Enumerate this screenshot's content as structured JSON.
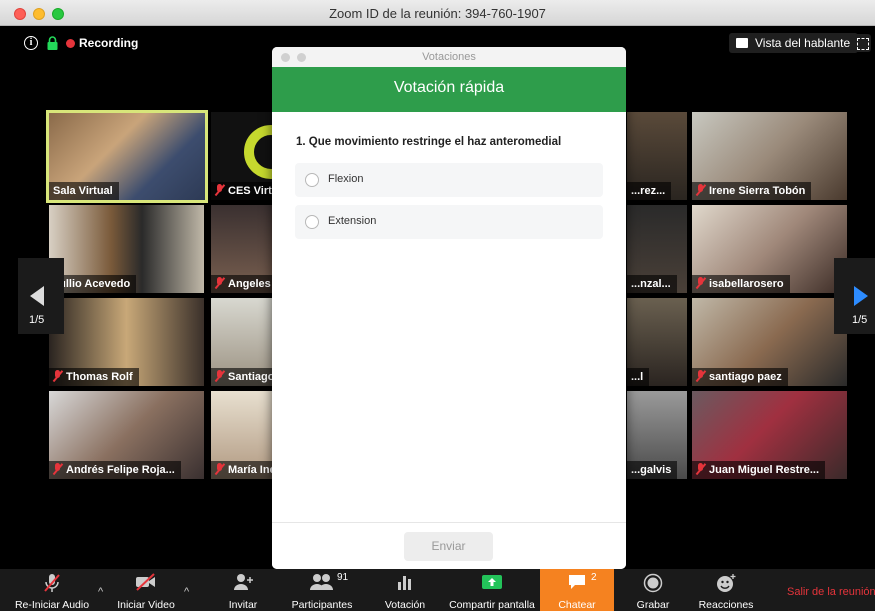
{
  "window": {
    "title": "Zoom ID de la reunión: 394-760-1907"
  },
  "topbar": {
    "recording_label": "Recording",
    "speaker_view_label": "Vista del hablante"
  },
  "grid": {
    "page_left": "1/5",
    "page_right": "1/5",
    "tiles": [
      {
        "name": "Sala Virtual",
        "muted": false
      },
      {
        "name": "CES Virtu",
        "muted": true
      },
      {
        "name": "...rez...",
        "muted": false
      },
      {
        "name": "Irene Sierra Tobón",
        "muted": true
      },
      {
        "name": "Jullio Acevedo",
        "muted": false
      },
      {
        "name": "Angeles",
        "muted": true
      },
      {
        "name": "...nzal...",
        "muted": false
      },
      {
        "name": "isabellarosero",
        "muted": true
      },
      {
        "name": "Thomas Rolf",
        "muted": true
      },
      {
        "name": "Santiago",
        "muted": true
      },
      {
        "name": "...l",
        "muted": false
      },
      {
        "name": "santiago paez",
        "muted": true
      },
      {
        "name": "Andrés Felipe Roja...",
        "muted": true
      },
      {
        "name": "María Iné",
        "muted": true
      },
      {
        "name": "...galvis",
        "muted": false
      },
      {
        "name": "Juan Miguel Restre...",
        "muted": true
      }
    ]
  },
  "poll": {
    "window_title": "Votaciones",
    "header": "Votación rápida",
    "question": "1. Que movimiento restringe el haz anteromedial",
    "options": [
      "Flexion",
      "Extension"
    ],
    "submit_label": "Enviar"
  },
  "toolbar": {
    "audio_label": "Re-Iniciar Audio",
    "video_label": "Iniciar Video",
    "invite_label": "Invitar",
    "participants_label": "Participantes",
    "participants_count": "91",
    "poll_label": "Votación",
    "share_label": "Compartir pantalla",
    "chat_label": "Chatear",
    "chat_count": "2",
    "record_label": "Grabar",
    "reactions_label": "Reacciones",
    "leave_label": "Salir de la reunión"
  },
  "colors": {
    "accent_green": "#2e9d4b",
    "chat_orange": "#f58220",
    "recording_red": "#e5343b",
    "active_speaker": "#d8e67a"
  }
}
